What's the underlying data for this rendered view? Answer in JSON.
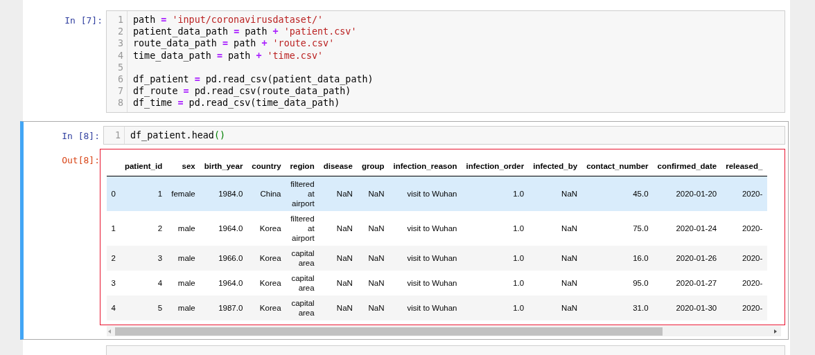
{
  "cells": [
    {
      "selected": false,
      "prompt": "In [7]:",
      "lines": [
        {
          "number": "1",
          "tokens": [
            {
              "kind": "name",
              "text": "path "
            },
            {
              "kind": "op",
              "text": "="
            },
            {
              "kind": "str",
              "text": " 'input/coronavirusdataset/'"
            }
          ]
        },
        {
          "number": "2",
          "tokens": [
            {
              "kind": "name",
              "text": "patient_data_path "
            },
            {
              "kind": "op",
              "text": "="
            },
            {
              "kind": "name",
              "text": " path "
            },
            {
              "kind": "op",
              "text": "+"
            },
            {
              "kind": "str",
              "text": " 'patient.csv'"
            }
          ]
        },
        {
          "number": "3",
          "tokens": [
            {
              "kind": "name",
              "text": "route_data_path "
            },
            {
              "kind": "op",
              "text": "="
            },
            {
              "kind": "name",
              "text": " path "
            },
            {
              "kind": "op",
              "text": "+"
            },
            {
              "kind": "str",
              "text": " 'route.csv'"
            }
          ]
        },
        {
          "number": "4",
          "tokens": [
            {
              "kind": "name",
              "text": "time_data_path "
            },
            {
              "kind": "op",
              "text": "="
            },
            {
              "kind": "name",
              "text": " path "
            },
            {
              "kind": "op",
              "text": "+"
            },
            {
              "kind": "str",
              "text": " 'time.csv'"
            }
          ]
        },
        {
          "number": "5"
        },
        {
          "number": "6",
          "tokens": [
            {
              "kind": "name",
              "text": "df_patient "
            },
            {
              "kind": "op",
              "text": "="
            },
            {
              "kind": "name",
              "text": " pd.read_csv(patient_data_path)"
            }
          ]
        },
        {
          "number": "7",
          "tokens": [
            {
              "kind": "name",
              "text": "df_route "
            },
            {
              "kind": "op",
              "text": "="
            },
            {
              "kind": "name",
              "text": " pd.read_csv(route_data_path)"
            }
          ]
        },
        {
          "number": "8",
          "tokens": [
            {
              "kind": "name",
              "text": "df_time "
            },
            {
              "kind": "op",
              "text": "="
            },
            {
              "kind": "name",
              "text": " pd.read_csv(time_data_path)"
            }
          ]
        }
      ]
    },
    {
      "selected": true,
      "prompt": "In [8]:",
      "lines": [
        {
          "number": "1",
          "tokens": [
            {
              "kind": "name",
              "text": "df_patient.head"
            },
            {
              "kind": "paren",
              "text": "()"
            }
          ]
        }
      ],
      "output": {
        "prompt": "Out[8]:",
        "highlighted": true,
        "columns": [
          "",
          "patient_id",
          "sex",
          "birth_year",
          "country",
          "region",
          "disease",
          "group",
          "infection_reason",
          "infection_order",
          "infected_by",
          "contact_number",
          "confirmed_date",
          "released_"
        ],
        "rows": [
          {
            "selected": true,
            "cells": [
              "0",
              "1",
              "female",
              "1984.0",
              "China",
              "filtered at airport",
              "NaN",
              "NaN",
              "visit to Wuhan",
              "1.0",
              "NaN",
              "45.0",
              "2020-01-20",
              "2020-"
            ]
          },
          {
            "selected": false,
            "cells": [
              "1",
              "2",
              "male",
              "1964.0",
              "Korea",
              "filtered at airport",
              "NaN",
              "NaN",
              "visit to Wuhan",
              "1.0",
              "NaN",
              "75.0",
              "2020-01-24",
              "2020-"
            ]
          },
          {
            "selected": false,
            "cells": [
              "2",
              "3",
              "male",
              "1966.0",
              "Korea",
              "capital area",
              "NaN",
              "NaN",
              "visit to Wuhan",
              "1.0",
              "NaN",
              "16.0",
              "2020-01-26",
              "2020-"
            ]
          },
          {
            "selected": false,
            "cells": [
              "3",
              "4",
              "male",
              "1964.0",
              "Korea",
              "capital area",
              "NaN",
              "NaN",
              "visit to Wuhan",
              "1.0",
              "NaN",
              "95.0",
              "2020-01-27",
              "2020-"
            ]
          },
          {
            "selected": false,
            "cells": [
              "4",
              "5",
              "male",
              "1987.0",
              "Korea",
              "capital area",
              "NaN",
              "NaN",
              "visit to Wuhan",
              "1.0",
              "NaN",
              "31.0",
              "2020-01-30",
              "2020-"
            ]
          }
        ]
      }
    }
  ]
}
